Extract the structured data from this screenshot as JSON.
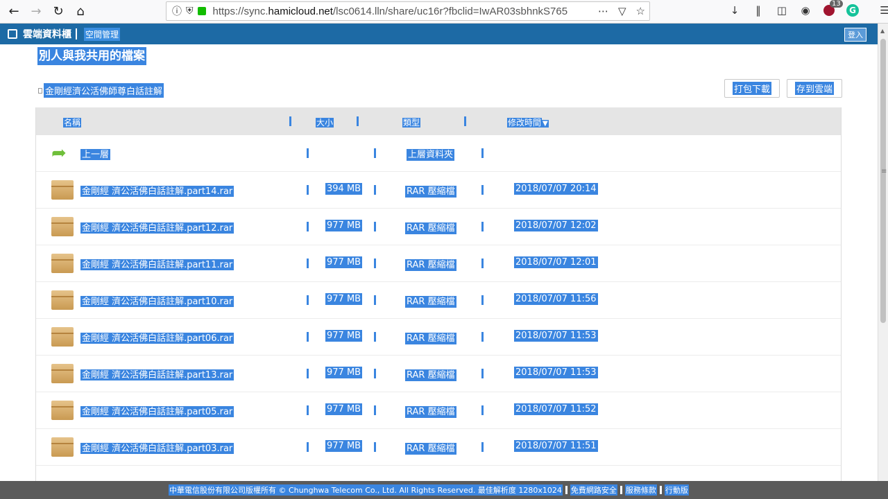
{
  "browser": {
    "url_prefix": "https://sync.",
    "url_domain": "hamicloud.net",
    "url_path": "/lsc0614.lln/share/uc16r?fbclid=IwAR03sbhnkS765",
    "badge_count": "13"
  },
  "header": {
    "site_title": "雲端資料櫃",
    "space_mgmt": "空間管理",
    "login": "登入"
  },
  "page": {
    "title": "別人與我共用的檔案",
    "breadcrumb": "金剛經濟公活佛師尊白話註解",
    "btn_pack": "打包下載",
    "btn_save": "存到雲端"
  },
  "table": {
    "headers": {
      "name": "名稱",
      "size": "大小",
      "type": "類型",
      "time": "修改時間"
    },
    "up_row": {
      "name": "上一層",
      "type": "上層資料夾"
    },
    "rows": [
      {
        "name": "金剛經 濟公活佛白話註解.part14.rar",
        "size": "394 MB",
        "type": "RAR 壓縮檔",
        "time": "2018/07/07 20:14"
      },
      {
        "name": "金剛經 濟公活佛白話註解.part12.rar",
        "size": "977 MB",
        "type": "RAR 壓縮檔",
        "time": "2018/07/07 12:02"
      },
      {
        "name": "金剛經 濟公活佛白話註解.part11.rar",
        "size": "977 MB",
        "type": "RAR 壓縮檔",
        "time": "2018/07/07 12:01"
      },
      {
        "name": "金剛經 濟公活佛白話註解.part10.rar",
        "size": "977 MB",
        "type": "RAR 壓縮檔",
        "time": "2018/07/07 11:56"
      },
      {
        "name": "金剛經 濟公活佛白話註解.part06.rar",
        "size": "977 MB",
        "type": "RAR 壓縮檔",
        "time": "2018/07/07 11:53"
      },
      {
        "name": "金剛經 濟公活佛白話註解.part13.rar",
        "size": "977 MB",
        "type": "RAR 壓縮檔",
        "time": "2018/07/07 11:53"
      },
      {
        "name": "金剛經 濟公活佛白話註解.part05.rar",
        "size": "977 MB",
        "type": "RAR 壓縮檔",
        "time": "2018/07/07 11:52"
      },
      {
        "name": "金剛經 濟公活佛白話註解.part03.rar",
        "size": "977 MB",
        "type": "RAR 壓縮檔",
        "time": "2018/07/07 11:51"
      }
    ]
  },
  "footer": {
    "copyright": "中華電信股份有限公司版權所有 © Chunghwa Telecom Co., Ltd. All Rights Reserved. 最佳解析度 1280x1024",
    "link_security": "免費網路安全",
    "link_terms": "服務條款",
    "link_mobile": "行動版"
  }
}
